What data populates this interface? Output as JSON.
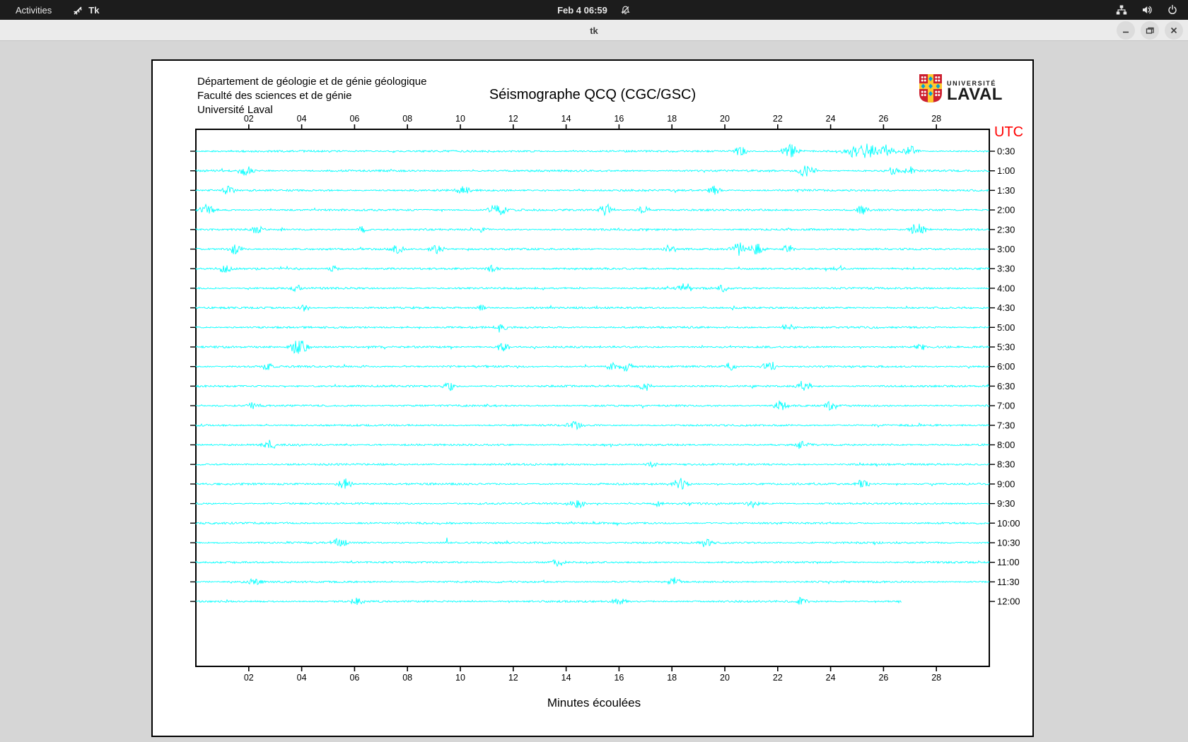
{
  "top_bar": {
    "activities_label": "Activities",
    "app_name": "Tk",
    "clock": "Feb 4 06:59",
    "icons": [
      "tk-feather-icon",
      "notifications-disabled-icon",
      "network-wired-icon",
      "volume-icon",
      "power-icon"
    ]
  },
  "titlebar": {
    "title": "tk",
    "controls": [
      "minimize",
      "maximize",
      "close"
    ]
  },
  "canvas": {
    "header_lines": [
      "Département de géologie et de génie géologique",
      "Faculté des sciences et de génie",
      "Université Laval"
    ],
    "logo": {
      "line1": "UNIVERSITÉ",
      "line2": "LAVAL",
      "colors": {
        "red": "#cc2030",
        "gold": "#ffc72c",
        "blue": "#00a0d6",
        "text": "#1a1a1a"
      }
    }
  },
  "chart_data": {
    "type": "line",
    "subtype": "helicorder-seismogram",
    "title": "Séismographe QCQ (CGC/GSC)",
    "xlabel": "Minutes écoulées",
    "right_axis_label": "UTC",
    "right_axis_label_color": "#ff0000",
    "x_range": [
      0,
      30
    ],
    "x_tick_values": [
      2,
      4,
      6,
      8,
      10,
      12,
      14,
      16,
      18,
      20,
      22,
      24,
      26,
      28
    ],
    "x_ticks": [
      "02",
      "04",
      "06",
      "08",
      "10",
      "12",
      "14",
      "16",
      "18",
      "20",
      "22",
      "24",
      "26",
      "28"
    ],
    "grid": false,
    "trace_color": "#00ffff",
    "axis_color": "#000000",
    "rows": [
      {
        "label": "0:30",
        "end": 30,
        "events": [
          [
            20.6,
            5
          ],
          [
            22.5,
            6
          ],
          [
            24.8,
            6
          ],
          [
            25.4,
            7
          ],
          [
            26.1,
            6
          ],
          [
            27.0,
            5
          ]
        ]
      },
      {
        "label": "1:00",
        "end": 30,
        "events": [
          [
            1.9,
            5
          ],
          [
            23.1,
            6
          ],
          [
            26.4,
            4
          ],
          [
            27.0,
            4
          ]
        ]
      },
      {
        "label": "1:30",
        "end": 30,
        "events": [
          [
            1.2,
            4
          ],
          [
            10.1,
            4
          ],
          [
            19.6,
            4
          ]
        ]
      },
      {
        "label": "2:00",
        "end": 30,
        "events": [
          [
            0.4,
            5
          ],
          [
            11.4,
            6
          ],
          [
            15.5,
            5
          ],
          [
            16.9,
            4
          ],
          [
            25.2,
            4
          ]
        ]
      },
      {
        "label": "2:30",
        "end": 30,
        "events": [
          [
            2.3,
            4
          ],
          [
            6.3,
            3
          ],
          [
            10.9,
            3
          ],
          [
            27.3,
            6
          ]
        ]
      },
      {
        "label": "3:00",
        "end": 30,
        "events": [
          [
            1.5,
            5
          ],
          [
            7.6,
            5
          ],
          [
            9.1,
            5
          ],
          [
            17.9,
            4
          ],
          [
            20.6,
            6
          ],
          [
            21.2,
            5
          ],
          [
            22.4,
            4
          ]
        ]
      },
      {
        "label": "3:30",
        "end": 30,
        "events": [
          [
            1.1,
            4
          ],
          [
            5.2,
            3
          ],
          [
            11.2,
            4
          ],
          [
            24.3,
            3
          ]
        ]
      },
      {
        "label": "4:00",
        "end": 30,
        "events": [
          [
            3.8,
            4
          ],
          [
            18.5,
            5
          ],
          [
            19.9,
            4
          ]
        ]
      },
      {
        "label": "4:30",
        "end": 30,
        "events": [
          [
            4.1,
            3
          ],
          [
            10.8,
            3
          ]
        ]
      },
      {
        "label": "5:00",
        "end": 30,
        "events": [
          [
            11.5,
            4
          ],
          [
            22.4,
            4
          ]
        ]
      },
      {
        "label": "5:30",
        "end": 30,
        "events": [
          [
            3.9,
            7
          ],
          [
            11.6,
            4
          ],
          [
            27.4,
            3
          ]
        ]
      },
      {
        "label": "6:00",
        "end": 30,
        "events": [
          [
            2.7,
            4
          ],
          [
            15.7,
            4
          ],
          [
            16.3,
            5
          ],
          [
            20.2,
            4
          ],
          [
            21.7,
            5
          ]
        ]
      },
      {
        "label": "6:30",
        "end": 30,
        "events": [
          [
            9.6,
            4
          ],
          [
            17.0,
            4
          ],
          [
            23.0,
            5
          ]
        ]
      },
      {
        "label": "7:00",
        "end": 30,
        "events": [
          [
            2.2,
            4
          ],
          [
            22.1,
            5
          ],
          [
            24.0,
            4
          ]
        ]
      },
      {
        "label": "7:30",
        "end": 30,
        "events": [
          [
            14.3,
            5
          ]
        ]
      },
      {
        "label": "8:00",
        "end": 30,
        "events": [
          [
            2.8,
            4
          ],
          [
            22.9,
            4
          ]
        ]
      },
      {
        "label": "8:30",
        "end": 30,
        "events": [
          [
            17.2,
            3
          ]
        ]
      },
      {
        "label": "9:00",
        "end": 30,
        "events": [
          [
            5.6,
            5
          ],
          [
            18.3,
            6
          ],
          [
            25.2,
            4
          ]
        ]
      },
      {
        "label": "9:30",
        "end": 30,
        "events": [
          [
            14.4,
            6
          ],
          [
            17.5,
            3
          ],
          [
            21.1,
            4
          ]
        ]
      },
      {
        "label": "10:00",
        "end": 30,
        "events": []
      },
      {
        "label": "10:30",
        "end": 30,
        "events": [
          [
            5.4,
            5
          ],
          [
            19.3,
            4
          ]
        ]
      },
      {
        "label": "11:00",
        "end": 30,
        "events": [
          [
            13.7,
            4
          ]
        ]
      },
      {
        "label": "11:30",
        "end": 30,
        "events": [
          [
            2.2,
            4
          ],
          [
            18.1,
            4
          ]
        ]
      },
      {
        "label": "12:00",
        "end": 26.7,
        "events": [
          [
            6.1,
            4
          ],
          [
            16.0,
            4
          ],
          [
            22.9,
            4
          ]
        ]
      }
    ]
  }
}
